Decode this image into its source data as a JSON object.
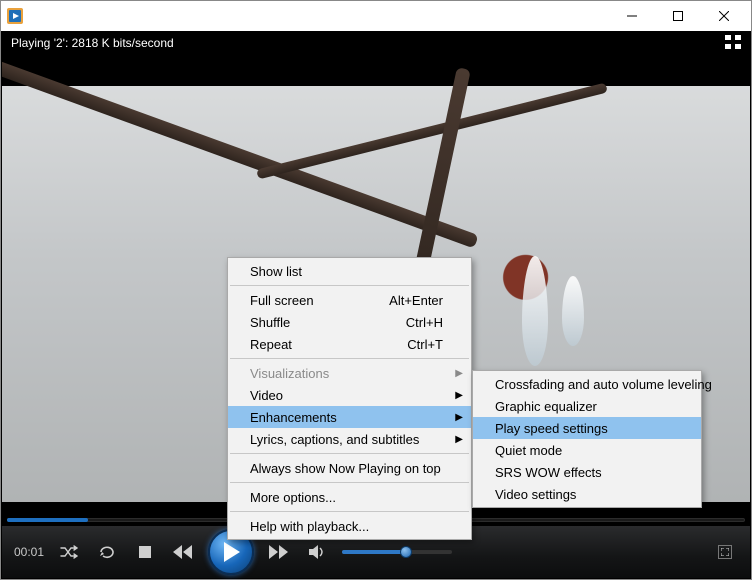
{
  "titlebar": {
    "app_name": ""
  },
  "status": {
    "text": "Playing '2': 2818 K bits/second"
  },
  "seek": {
    "progress_pct": 11
  },
  "playback": {
    "time_elapsed": "00:01"
  },
  "volume": {
    "level_pct": 58
  },
  "menu": {
    "items": [
      {
        "label": "Show list",
        "shortcut": "",
        "submenu": false,
        "enabled": true
      },
      {
        "sep": true
      },
      {
        "label": "Full screen",
        "shortcut": "Alt+Enter",
        "submenu": false,
        "enabled": true
      },
      {
        "label": "Shuffle",
        "shortcut": "Ctrl+H",
        "submenu": false,
        "enabled": true
      },
      {
        "label": "Repeat",
        "shortcut": "Ctrl+T",
        "submenu": false,
        "enabled": true
      },
      {
        "sep": true
      },
      {
        "label": "Visualizations",
        "shortcut": "",
        "submenu": true,
        "enabled": false
      },
      {
        "label": "Video",
        "shortcut": "",
        "submenu": true,
        "enabled": true
      },
      {
        "label": "Enhancements",
        "shortcut": "",
        "submenu": true,
        "enabled": true,
        "hover": true
      },
      {
        "label": "Lyrics, captions, and subtitles",
        "shortcut": "",
        "submenu": true,
        "enabled": true
      },
      {
        "sep": true
      },
      {
        "label": "Always show Now Playing on top",
        "shortcut": "",
        "submenu": false,
        "enabled": true
      },
      {
        "sep": true
      },
      {
        "label": "More options...",
        "shortcut": "",
        "submenu": false,
        "enabled": true
      },
      {
        "sep": true
      },
      {
        "label": "Help with playback...",
        "shortcut": "",
        "submenu": false,
        "enabled": true
      }
    ]
  },
  "submenu": {
    "items": [
      {
        "label": "Crossfading and auto volume leveling",
        "hover": false
      },
      {
        "label": "Graphic equalizer",
        "hover": false
      },
      {
        "label": "Play speed settings",
        "hover": true
      },
      {
        "label": "Quiet mode",
        "hover": false
      },
      {
        "label": "SRS WOW effects",
        "hover": false
      },
      {
        "label": "Video settings",
        "hover": false
      }
    ]
  }
}
